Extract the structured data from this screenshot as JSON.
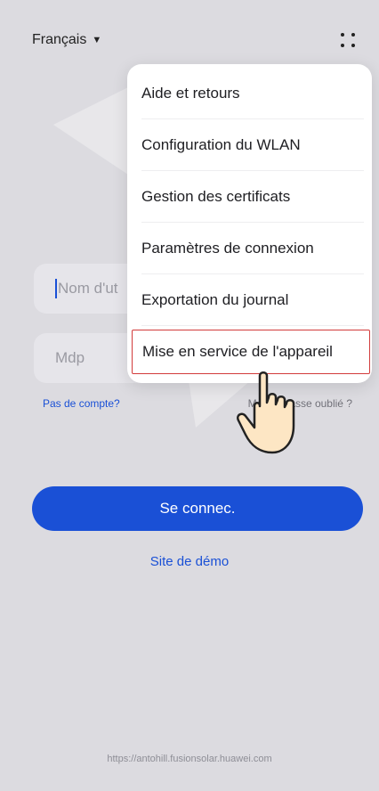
{
  "header": {
    "language": "Français"
  },
  "form": {
    "username_placeholder": "Nom d'ut",
    "password_placeholder": "Mdp",
    "no_account_link": "Pas de compte?",
    "forgot_password_link": "Mot de passe oublié ?",
    "login_button": "Se connec.",
    "demo_link": "Site de démo"
  },
  "menu": {
    "items": [
      "Aide et retours",
      "Configuration du WLAN",
      "Gestion des certificats",
      "Paramètres de connexion",
      "Exportation du journal",
      "Mise en service de l'appareil"
    ]
  },
  "footer": {
    "url": "https://antohill.fusionsolar.huawei.com"
  },
  "colors": {
    "accent": "#1a50d6",
    "highlight_border": "#d23b3b",
    "background": "#dcdbe0"
  }
}
